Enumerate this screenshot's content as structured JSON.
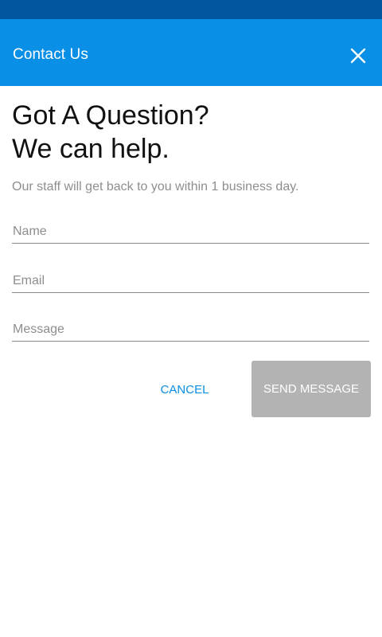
{
  "status_bar": {
    "color": "#0256a0"
  },
  "app_bar": {
    "title": "Contact Us",
    "close_icon": "close-icon",
    "color": "#0a8fe6"
  },
  "hero": {
    "line1": "Got A Question?",
    "line2": "We can help."
  },
  "subtitle": "Our staff will get back to you within 1 business day.",
  "form": {
    "name": {
      "placeholder": "Name",
      "value": ""
    },
    "email": {
      "placeholder": "Email",
      "value": ""
    },
    "message": {
      "placeholder": "Message",
      "value": ""
    }
  },
  "actions": {
    "cancel_label": "CANCEL",
    "send_label": "SEND MESSAGE",
    "accent_color": "#0a8fe6",
    "disabled_color": "#b3b3b3"
  }
}
